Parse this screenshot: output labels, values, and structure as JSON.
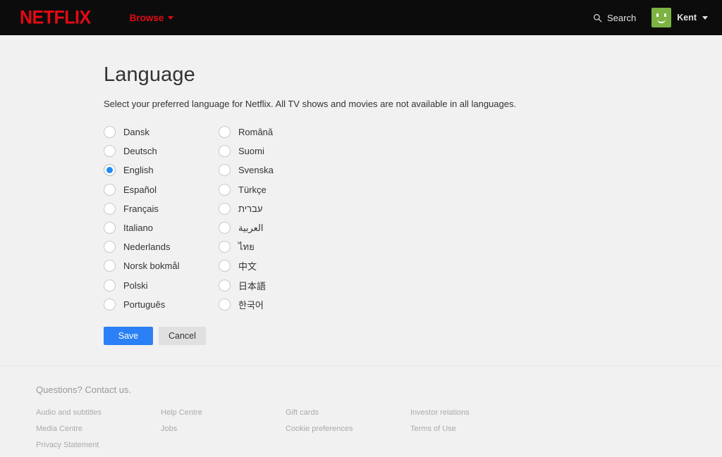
{
  "header": {
    "logo": "NETFLIX",
    "browse_label": "Browse",
    "search_label": "Search",
    "account_name": "Kent"
  },
  "main": {
    "title": "Language",
    "subtitle": "Select your preferred language for Netflix. All TV shows and movies are not available in all languages.",
    "languages_left": [
      {
        "label": "Dansk",
        "selected": false
      },
      {
        "label": "Deutsch",
        "selected": false
      },
      {
        "label": "English",
        "selected": true
      },
      {
        "label": "Español",
        "selected": false
      },
      {
        "label": "Français",
        "selected": false
      },
      {
        "label": "Italiano",
        "selected": false
      },
      {
        "label": "Nederlands",
        "selected": false
      },
      {
        "label": "Norsk bokmål",
        "selected": false
      },
      {
        "label": "Polski",
        "selected": false
      },
      {
        "label": "Português",
        "selected": false
      }
    ],
    "languages_right": [
      {
        "label": "Română",
        "selected": false
      },
      {
        "label": "Suomi",
        "selected": false
      },
      {
        "label": "Svenska",
        "selected": false
      },
      {
        "label": "Türkçe",
        "selected": false
      },
      {
        "label": "עברית",
        "selected": false
      },
      {
        "label": "العربية",
        "selected": false
      },
      {
        "label": "ไทย",
        "selected": false
      },
      {
        "label": "中文",
        "selected": false
      },
      {
        "label": "日本語",
        "selected": false
      },
      {
        "label": "한국어",
        "selected": false
      }
    ],
    "save_label": "Save",
    "cancel_label": "Cancel"
  },
  "footer": {
    "contact": "Questions? Contact us.",
    "columns": [
      [
        "Audio and subtitles",
        "Media Centre",
        "Privacy Statement"
      ],
      [
        "Help Centre",
        "Jobs"
      ],
      [
        "Gift cards",
        "Cookie preferences"
      ],
      [
        "Investor relations",
        "Terms of Use"
      ]
    ]
  },
  "colors": {
    "brand_red": "#e50914",
    "header_bg": "#0c0c0c",
    "page_bg": "#f1f1f1",
    "accent_blue": "#2a80f4",
    "radio_blue": "#1f8af5",
    "avatar_green": "#7cb342"
  }
}
